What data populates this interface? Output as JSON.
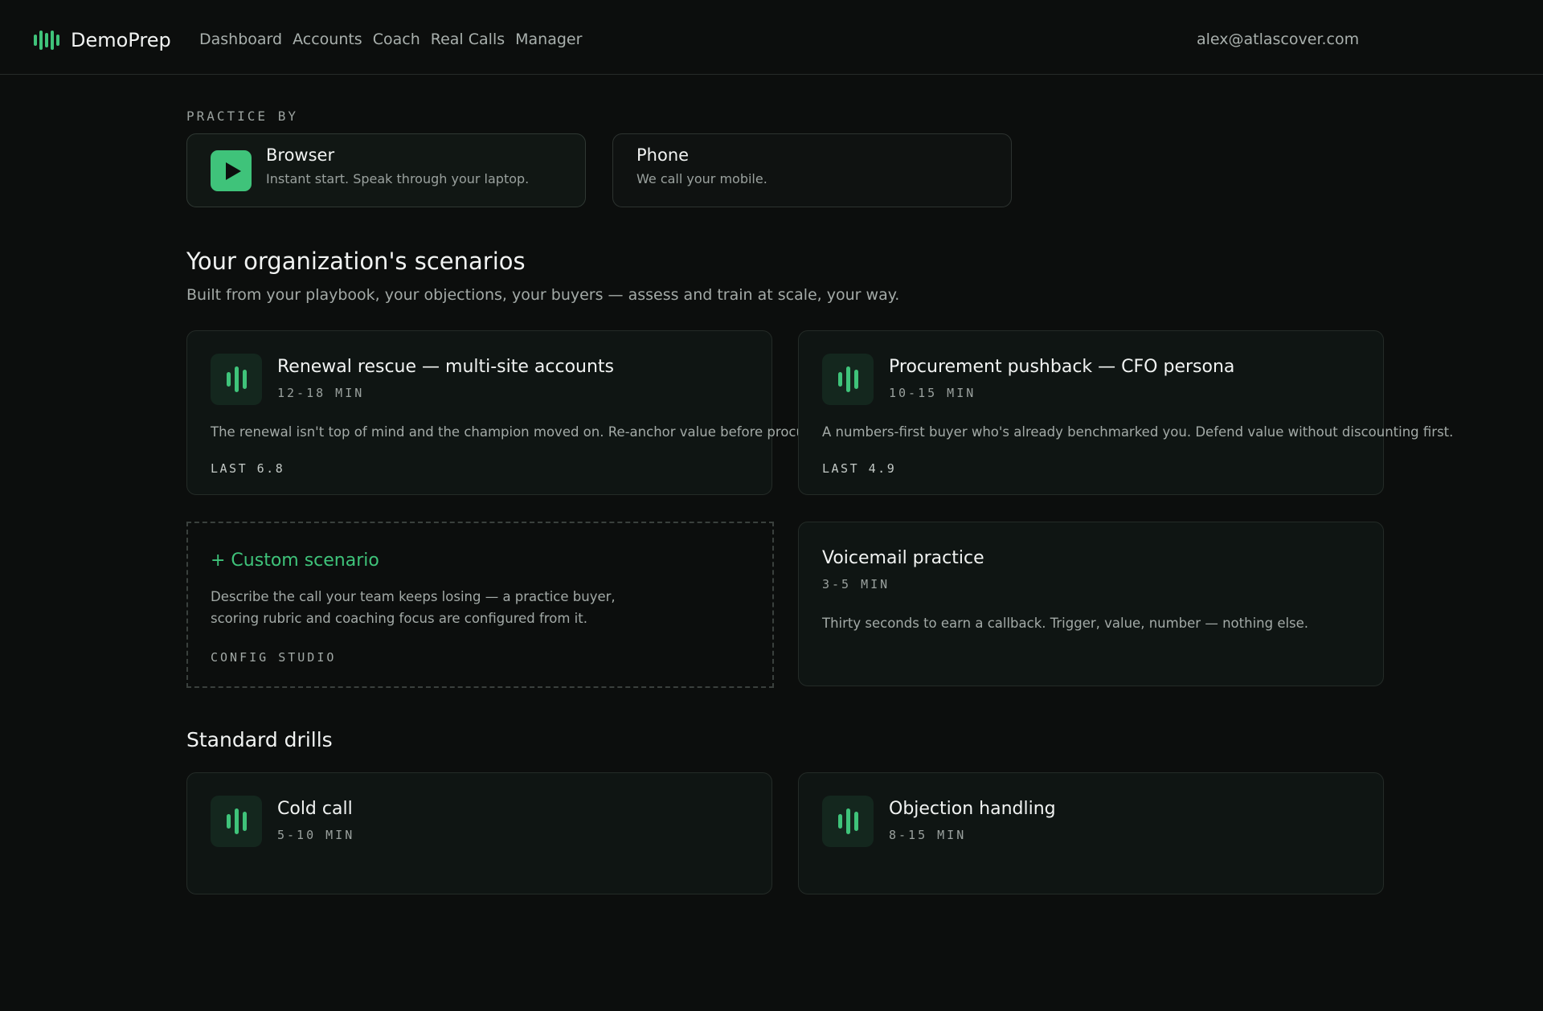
{
  "app": {
    "name": "DemoPrep",
    "user_email": "alex@atlascover.com"
  },
  "nav": {
    "items": [
      {
        "label": "Dashboard"
      },
      {
        "label": "Accounts"
      },
      {
        "label": "Coach"
      },
      {
        "label": "Real Calls"
      },
      {
        "label": "Manager"
      }
    ]
  },
  "practice": {
    "label": "PRACTICE BY",
    "modes": [
      {
        "title": "Browser",
        "desc": "Instant start. Speak through your laptop.",
        "selected": true,
        "icon": "play-icon"
      },
      {
        "title": "Phone",
        "desc": "We call your mobile.",
        "selected": false
      }
    ]
  },
  "org": {
    "title": "Your organization's scenarios",
    "subtitle": "Built from your playbook, your objections, your buyers — assess and train at scale, your way.",
    "scenarios": [
      {
        "title": "Renewal rescue — multi-site accounts",
        "duration": "12-18 MIN",
        "desc": "The renewal isn't top of mind and the champion moved on. Re-anchor value before procurem",
        "last": "LAST 6.8"
      },
      {
        "title": "Procurement pushback — CFO persona",
        "duration": "10-15 MIN",
        "desc": "A numbers-first buyer who's already benchmarked you. Defend value without discounting first.",
        "last": "LAST 4.9"
      }
    ],
    "custom": {
      "title": "+ Custom scenario",
      "desc": "Describe the call your team keeps losing — a practice buyer, scoring rubric and coaching focus are configured from it.",
      "link": "CONFIG STUDIO"
    },
    "voicemail": {
      "title": "Voicemail practice",
      "duration": "3-5 MIN",
      "desc": "Thirty seconds to earn a callback. Trigger, value, number — nothing else."
    }
  },
  "drills": {
    "title": "Standard drills",
    "items": [
      {
        "title": "Cold call",
        "duration": "5-10 MIN"
      },
      {
        "title": "Objection handling",
        "duration": "8-15 MIN"
      }
    ]
  },
  "colors": {
    "accent": "#3fc37a",
    "background": "#0c0e0d",
    "card": "#0f1513",
    "icon_tile": "#14271e"
  }
}
